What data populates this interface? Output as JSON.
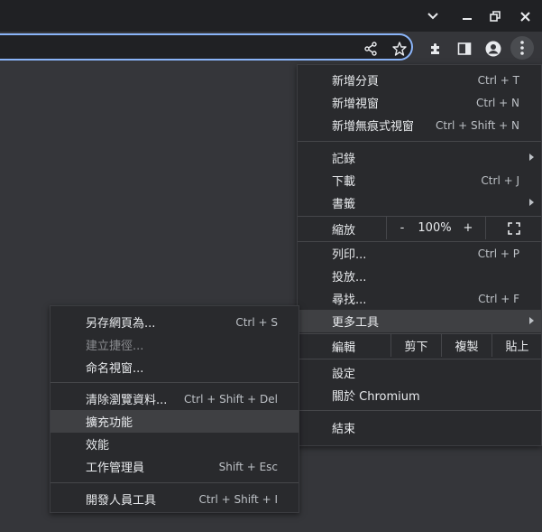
{
  "window_controls": {
    "minimize": "–",
    "maximize": "⧉",
    "close": "✕",
    "tab_search": "⌄"
  },
  "main_menu": {
    "items": [
      {
        "label": "新增分頁",
        "shortcut": "Ctrl + T"
      },
      {
        "label": "新增視窗",
        "shortcut": "Ctrl + N"
      },
      {
        "label": "新增無痕式視窗",
        "shortcut": "Ctrl + Shift + N"
      },
      {
        "label": "記錄",
        "shortcut": ""
      },
      {
        "label": "下載",
        "shortcut": "Ctrl + J"
      },
      {
        "label": "書籤",
        "shortcut": ""
      },
      {
        "label": "列印...",
        "shortcut": "Ctrl + P"
      },
      {
        "label": "投放...",
        "shortcut": ""
      },
      {
        "label": "尋找...",
        "shortcut": "Ctrl + F"
      },
      {
        "label": "更多工具",
        "shortcut": ""
      },
      {
        "label": "設定",
        "shortcut": ""
      },
      {
        "label": "關於 Chromium",
        "shortcut": ""
      },
      {
        "label": "結束",
        "shortcut": ""
      }
    ],
    "zoom": {
      "label": "縮放",
      "minus": "-",
      "value": "100%",
      "plus": "+"
    },
    "edit": {
      "label": "編輯",
      "cut": "剪下",
      "copy": "複製",
      "paste": "貼上"
    }
  },
  "submenu": {
    "items": [
      {
        "label": "另存網頁為...",
        "shortcut": "Ctrl + S"
      },
      {
        "label": "建立捷徑...",
        "shortcut": ""
      },
      {
        "label": "命名視窗...",
        "shortcut": ""
      },
      {
        "label": "清除瀏覽資料...",
        "shortcut": "Ctrl + Shift + Del"
      },
      {
        "label": "擴充功能",
        "shortcut": ""
      },
      {
        "label": "效能",
        "shortcut": ""
      },
      {
        "label": "工作管理員",
        "shortcut": "Shift + Esc"
      },
      {
        "label": "開發人員工具",
        "shortcut": "Ctrl + Shift + I"
      }
    ]
  }
}
